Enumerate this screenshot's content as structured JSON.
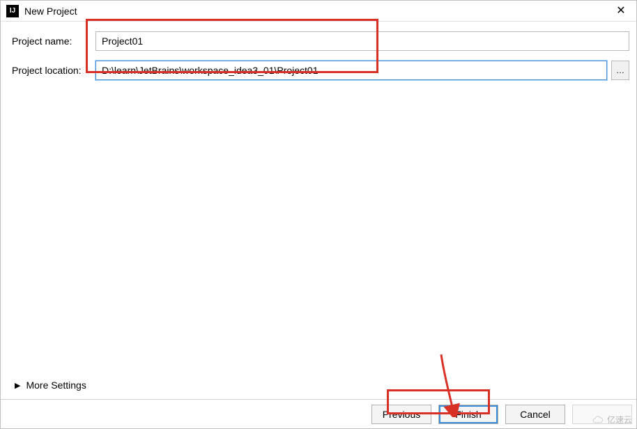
{
  "window": {
    "title": "New Project",
    "app_icon_text": "IJ",
    "close_glyph": "✕"
  },
  "form": {
    "name_label": "Project name:",
    "name_value": "Project01",
    "location_label": "Project location:",
    "location_value": "D:\\learn\\JetBrains\\workspace_idea3_01\\Project01",
    "browse_label": "…"
  },
  "more_settings": {
    "label": "More Settings",
    "triangle": "▶"
  },
  "buttons": {
    "previous": "Previous",
    "finish": "Finish",
    "cancel": "Cancel"
  },
  "watermark": {
    "text": "亿速云"
  },
  "annotation_colors": {
    "highlight": "#d93025",
    "arrow": "#d93025"
  }
}
